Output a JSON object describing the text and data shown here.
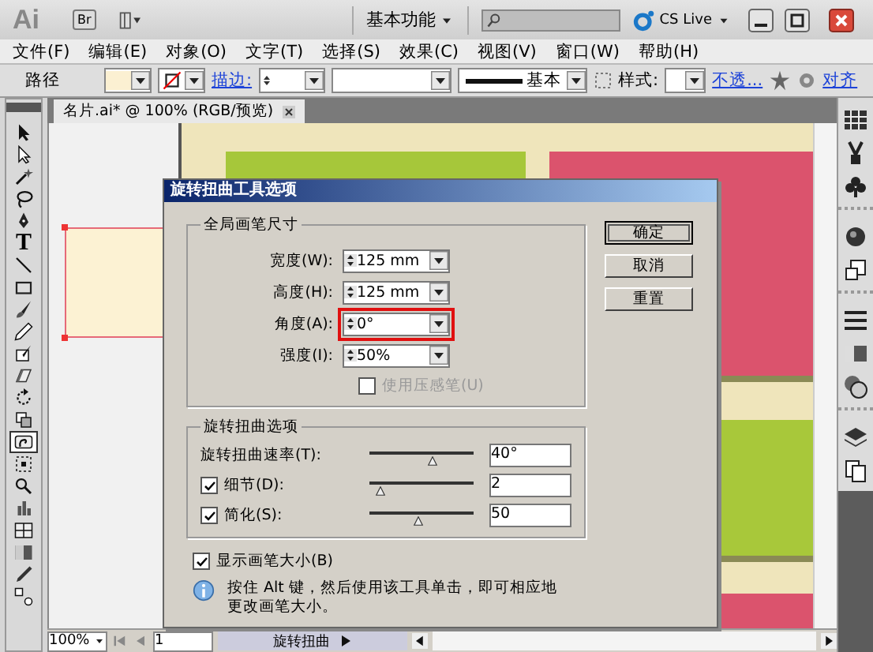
{
  "app_bar": {
    "logo": "Ai",
    "bridge": "Br",
    "workspace": "基本功能",
    "cs_live": "CS Live"
  },
  "menu": [
    {
      "label": "文件(F)"
    },
    {
      "label": "编辑(E)"
    },
    {
      "label": "对象(O)"
    },
    {
      "label": "文字(T)"
    },
    {
      "label": "选择(S)"
    },
    {
      "label": "效果(C)"
    },
    {
      "label": "视图(V)"
    },
    {
      "label": "窗口(W)"
    },
    {
      "label": "帮助(H)"
    }
  ],
  "control_bar": {
    "selection": "路径",
    "stroke_label": "描边:",
    "stroke_profile": "基本",
    "style_label": "样式:",
    "opacity_link": "不透...",
    "align_link": "对齐"
  },
  "tools": [
    {
      "kind": "select",
      "selected": false
    },
    {
      "kind": "direct",
      "selected": false
    },
    {
      "kind": "wand",
      "selected": false
    },
    {
      "kind": "lasso",
      "selected": false
    },
    {
      "kind": "pen",
      "selected": false
    },
    {
      "kind": "type",
      "glyph": "T",
      "selected": false
    },
    {
      "kind": "line",
      "selected": false
    },
    {
      "kind": "rect",
      "selected": false
    },
    {
      "kind": "brush",
      "selected": false
    },
    {
      "kind": "pencil",
      "selected": false
    },
    {
      "kind": "blob",
      "selected": false
    },
    {
      "kind": "eraser",
      "selected": false
    },
    {
      "kind": "rotate",
      "selected": false
    },
    {
      "kind": "scale",
      "selected": false
    },
    {
      "kind": "twirl",
      "selected": true
    },
    {
      "kind": "transform",
      "selected": false
    },
    {
      "kind": "sprayer",
      "selected": false
    },
    {
      "kind": "graph",
      "selected": false
    },
    {
      "kind": "mesh",
      "selected": false
    },
    {
      "kind": "gradient",
      "selected": false
    },
    {
      "kind": "eyedropper",
      "selected": false
    },
    {
      "kind": "blend",
      "selected": false
    }
  ],
  "document_tab": {
    "title": "名片.ai* @ 100% (RGB/预览)"
  },
  "dialog": {
    "title": "旋转扭曲工具选项",
    "brush_group": {
      "title": "全局画笔尺寸",
      "fields": [
        {
          "label": "宽度(W):",
          "value": "125 mm",
          "highlighted": false
        },
        {
          "label": "高度(H):",
          "value": "125 mm",
          "highlighted": false
        },
        {
          "label": "角度(A):",
          "value": "0°",
          "highlighted": true
        },
        {
          "label": "强度(I):",
          "value": "50%",
          "highlighted": false
        }
      ],
      "pressure": {
        "label": "使用压感笔(U)",
        "checked": false,
        "disabled": true
      }
    },
    "twirl_group": {
      "title": "旋转扭曲选项",
      "rows": [
        {
          "kind": "slider",
          "label": "旋转扭曲速率(T):",
          "level": 0.6,
          "value": "40°"
        },
        {
          "kind": "check_slider",
          "label": "细节(D):",
          "checked": true,
          "level": 0.1,
          "value": "2"
        },
        {
          "kind": "check_slider",
          "label": "简化(S):",
          "checked": true,
          "level": 0.47,
          "value": "50"
        }
      ]
    },
    "show_size": {
      "label": "显示画笔大小(B)",
      "checked": true
    },
    "info": "按住 Alt 键，然后使用该工具单击，即可相应地更改画笔大小。",
    "buttons": [
      {
        "label": "确定",
        "default": true
      },
      {
        "label": "取消",
        "default": false
      },
      {
        "label": "重置",
        "default": false
      }
    ]
  },
  "dock": [
    {
      "kind": "swatches"
    },
    {
      "kind": "brushes"
    },
    {
      "kind": "symbols"
    },
    {
      "kind": "appearance"
    },
    {
      "kind": "styles"
    },
    {
      "kind": "stroke"
    },
    {
      "kind": "gradient"
    },
    {
      "kind": "transparency"
    },
    {
      "kind": "layers"
    },
    {
      "kind": "artboards"
    }
  ],
  "status_bar": {
    "zoom": "100%",
    "page": "1",
    "tool": "旋转扭曲"
  }
}
